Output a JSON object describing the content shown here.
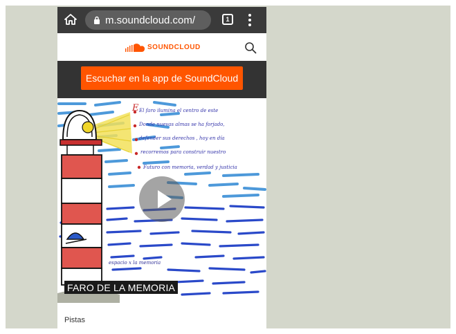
{
  "browser": {
    "url": "m.soundcloud.com/",
    "tab_count": "1"
  },
  "header": {
    "logo_text": "SOUNDCLOUD"
  },
  "banner": {
    "app_button_label": "Escuchar en la app de SoundCloud"
  },
  "artwork": {
    "handwritten_lines": [
      "El faro ilumina el centro de este",
      "Donde nuevas almas se ha forjado,",
      "defender sus derechos , hoy en día",
      "recorremos para construir nuestro",
      "Futuro con memoria, verdad y justicia"
    ],
    "caption": "espacio x la memoria"
  },
  "track": {
    "title": "FARO DE LA MEMORIA"
  },
  "section": {
    "pistas_label": "Pistas"
  },
  "colors": {
    "brand": "#ff5500",
    "chrome": "#3a3a3a",
    "banner": "#333333",
    "page_bg": "#d4d7cb"
  }
}
